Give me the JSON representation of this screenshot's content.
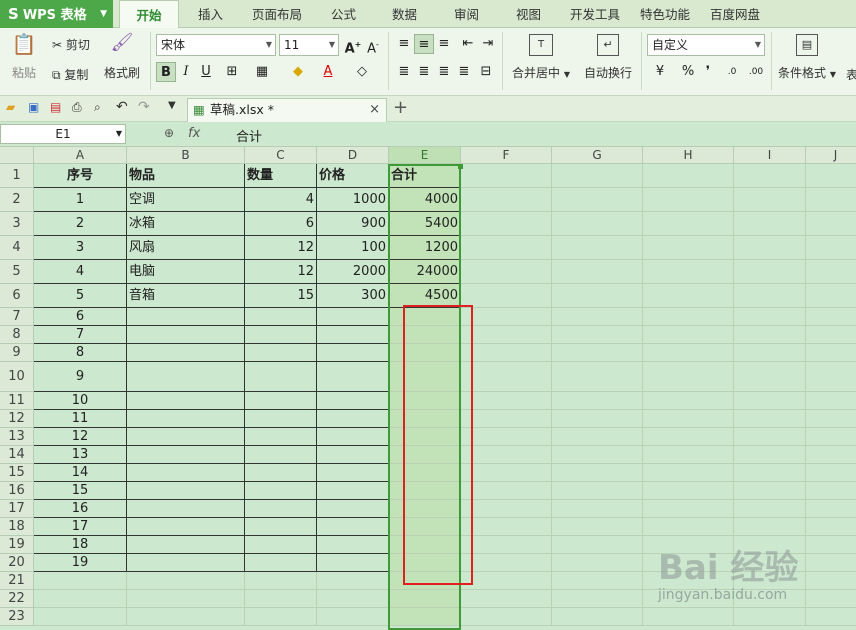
{
  "app": {
    "logo_text": "WPS 表格"
  },
  "menu": [
    {
      "label": "开始",
      "active": true
    },
    {
      "label": "插入"
    },
    {
      "label": "页面布局"
    },
    {
      "label": "公式"
    },
    {
      "label": "数据"
    },
    {
      "label": "审阅"
    },
    {
      "label": "视图"
    },
    {
      "label": "开发工具"
    },
    {
      "label": "特色功能"
    },
    {
      "label": "百度网盘"
    }
  ],
  "ribbon": {
    "paste": "粘贴",
    "cut": "剪切",
    "copy": "复制",
    "format_painter": "格式刷",
    "font_name": "宋体",
    "font_size": "11",
    "merge_center": "合并居中",
    "wrap_text": "自动换行",
    "number_format": "自定义",
    "percent": "%",
    "comma": "❜",
    "conditional_format": "条件格式",
    "table_style": "表"
  },
  "document": {
    "tab_title": "草稿.xlsx *"
  },
  "formula_bar": {
    "name_box": "E1",
    "fx": "fx",
    "content": "合计"
  },
  "columns": [
    "A",
    "B",
    "C",
    "D",
    "E",
    "F",
    "G",
    "H",
    "I",
    "J"
  ],
  "rows": [
    "1",
    "2",
    "3",
    "4",
    "5",
    "6",
    "7",
    "8",
    "9",
    "10",
    "11",
    "12",
    "13",
    "14",
    "15",
    "16",
    "17",
    "18",
    "19",
    "20",
    "21",
    "22",
    "23"
  ],
  "table": {
    "headers": [
      "序号",
      "物品",
      "数量",
      "价格",
      "合计"
    ],
    "data": [
      [
        "1",
        "空调",
        "4",
        "1000",
        "4000"
      ],
      [
        "2",
        "冰箱",
        "6",
        "900",
        "5400"
      ],
      [
        "3",
        "风扇",
        "12",
        "100",
        "1200"
      ],
      [
        "4",
        "电脑",
        "12",
        "2000",
        "24000"
      ],
      [
        "5",
        "音箱",
        "15",
        "300",
        "4500"
      ]
    ],
    "extra_seq": [
      "6",
      "7",
      "8",
      "9",
      "10",
      "11",
      "12",
      "13",
      "14",
      "15",
      "16",
      "17",
      "18",
      "19"
    ]
  },
  "watermark": {
    "brand": "Bai 经验",
    "url": "jingyan.baidu.com"
  },
  "colors": {
    "accent": "#4da84a",
    "sheet_bg": "#cce8cf",
    "highlight_box": "#e02020",
    "selection": "#3c9a37"
  }
}
